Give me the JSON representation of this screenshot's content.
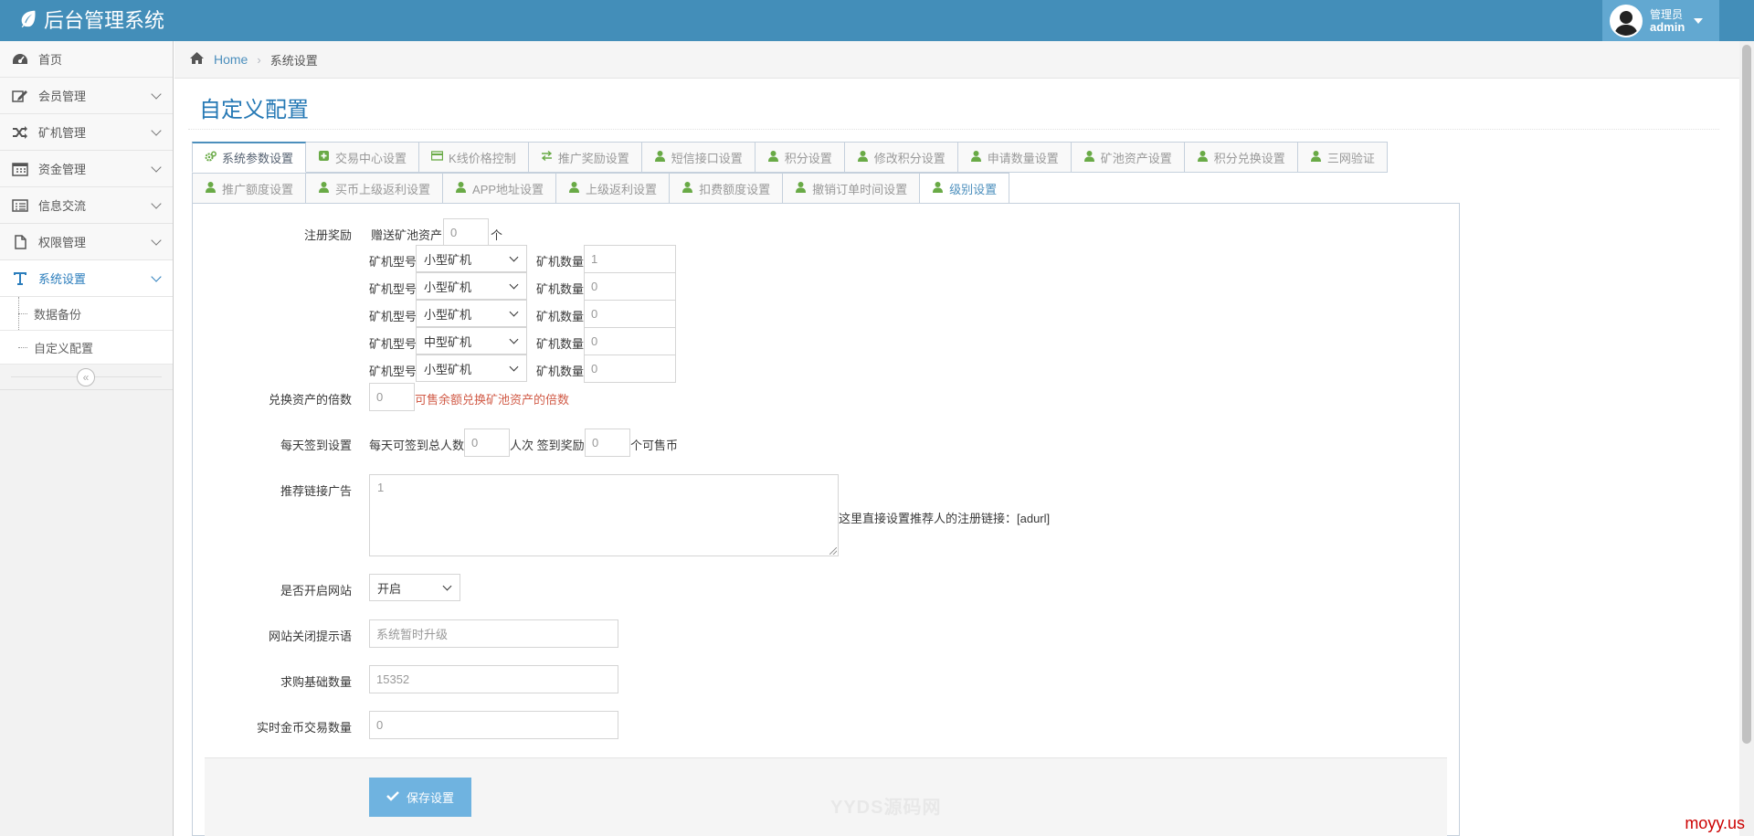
{
  "app": {
    "title": "后台管理系统"
  },
  "user": {
    "role": "管理员",
    "name": "admin"
  },
  "sidebar": {
    "items": [
      {
        "label": "首页",
        "icon": "dashboard-icon"
      },
      {
        "label": "会员管理",
        "icon": "edit-icon"
      },
      {
        "label": "矿机管理",
        "icon": "random-icon"
      },
      {
        "label": "资金管理",
        "icon": "calendar-icon"
      },
      {
        "label": "信息交流",
        "icon": "list-icon"
      },
      {
        "label": "权限管理",
        "icon": "file-icon"
      },
      {
        "label": "系统设置",
        "icon": "text-icon"
      }
    ],
    "sub_items": [
      {
        "label": "数据备份"
      },
      {
        "label": "自定义配置"
      }
    ],
    "collapse_glyph": "«"
  },
  "breadcrumb": {
    "home": "Home",
    "current": "系统设置"
  },
  "page": {
    "title": "自定义配置"
  },
  "tabs": {
    "row1": [
      {
        "label": "系统参数设置",
        "icon": "cogs-icon"
      },
      {
        "label": "交易中心设置",
        "icon": "plus-square-icon"
      },
      {
        "label": "K线价格控制",
        "icon": "credit-card-icon"
      },
      {
        "label": "推广奖励设置",
        "icon": "exchange-icon"
      },
      {
        "label": "短信接口设置",
        "icon": "user-icon"
      },
      {
        "label": "积分设置",
        "icon": "user-icon"
      },
      {
        "label": "修改积分设置",
        "icon": "user-icon"
      },
      {
        "label": "申请数量设置",
        "icon": "user-icon"
      },
      {
        "label": "矿池资产设置",
        "icon": "user-icon"
      },
      {
        "label": "积分兑换设置",
        "icon": "user-icon"
      },
      {
        "label": "三网验证",
        "icon": "user-icon"
      }
    ],
    "row2": [
      {
        "label": "推广额度设置",
        "icon": "user-icon"
      },
      {
        "label": "买币上级返利设置",
        "icon": "user-icon"
      },
      {
        "label": "APP地址设置",
        "icon": "user-icon"
      },
      {
        "label": "上级返利设置",
        "icon": "user-icon"
      },
      {
        "label": "扣费额度设置",
        "icon": "user-icon"
      },
      {
        "label": "撤销订单时间设置",
        "icon": "user-icon"
      },
      {
        "label": "级别设置",
        "icon": "user-icon"
      }
    ]
  },
  "form": {
    "register_reward": {
      "label": "注册奖励",
      "gift_prefix": "赠送矿池资产",
      "gift_value": "0",
      "gift_suffix": "个",
      "machines": [
        {
          "type_label": "矿机型号",
          "type_value": "小型矿机",
          "count_label": "矿机数量",
          "count_value": "1"
        },
        {
          "type_label": "矿机型号",
          "type_value": "小型矿机",
          "count_label": "矿机数量",
          "count_value": "0"
        },
        {
          "type_label": "矿机型号",
          "type_value": "小型矿机",
          "count_label": "矿机数量",
          "count_value": "0"
        },
        {
          "type_label": "矿机型号",
          "type_value": "中型矿机",
          "count_label": "矿机数量",
          "count_value": "0"
        },
        {
          "type_label": "矿机型号",
          "type_value": "小型矿机",
          "count_label": "矿机数量",
          "count_value": "0"
        }
      ]
    },
    "exchange_multiple": {
      "label": "兑换资产的倍数",
      "value": "0",
      "hint": "可售余额兑换矿池资产的倍数"
    },
    "daily_checkin": {
      "label": "每天签到设置",
      "prefix": "每天可签到总人数",
      "total_value": "0",
      "middle": "人次 签到奖励",
      "reward_value": "0",
      "suffix": "个可售币"
    },
    "ad_link": {
      "label": "推荐链接广告",
      "value": "1",
      "hint": "这里直接设置推荐人的注册链接：[adurl]"
    },
    "site_open": {
      "label": "是否开启网站",
      "value": "开启"
    },
    "close_msg": {
      "label": "网站关闭提示语",
      "value": "系统暂时升级"
    },
    "buy_base": {
      "label": "求购基础数量",
      "value": "15352"
    },
    "realtime_gold": {
      "label": "实时金币交易数量",
      "value": "0"
    },
    "save_label": "保存设置"
  },
  "watermark": "YYDS源码网",
  "corner_mark": "moyy.us"
}
